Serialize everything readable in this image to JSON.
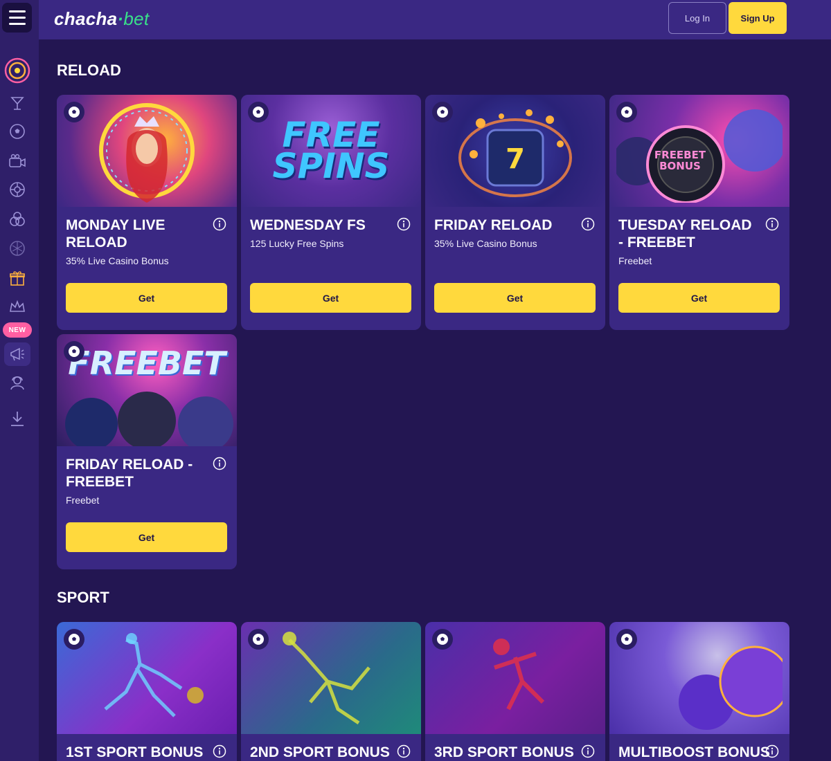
{
  "header": {
    "logo_main": "chacha",
    "logo_dot": "·",
    "logo_bet": "bet",
    "login_label": "Log In",
    "signup_label": "Sign Up"
  },
  "sidebar": {
    "new_badge": "NEW",
    "items": [
      "target-icon",
      "cocktail-icon",
      "soccer-ball-icon",
      "live-camera-icon",
      "roulette-icon",
      "cards-icon",
      "soccer-ball-alt-icon",
      "gift-icon",
      "crown-icon",
      "megaphone-icon",
      "support-icon",
      "download-icon"
    ]
  },
  "sections": [
    {
      "title": "RELOAD",
      "cards": [
        {
          "title": "MONDAY LIVE RELOAD",
          "subtitle": "35% Live Casino Bonus",
          "button": "Get",
          "art": "queen"
        },
        {
          "title": "WEDNESDAY FS",
          "subtitle": "125 Lucky Free Spins",
          "button": "Get",
          "art_text": "FREE SPINS"
        },
        {
          "title": "FRIDAY RELOAD",
          "subtitle": "35% Live Casino Bonus",
          "button": "Get",
          "art": "slot"
        },
        {
          "title": "TUESDAY RELOAD - FREEBET",
          "subtitle": "Freebet",
          "button": "Get",
          "art_text": "FREEBET BONUS"
        },
        {
          "title": "FRIDAY RELOAD - FREEBET",
          "subtitle": "Freebet",
          "button": "Get",
          "art_text": "FREEBET"
        }
      ]
    },
    {
      "title": "SPORT",
      "cards": [
        {
          "title": "1ST SPORT BONUS",
          "art": "soccer-player"
        },
        {
          "title": "2ND SPORT BONUS",
          "art": "goalkeeper"
        },
        {
          "title": "3RD SPORT BONUS",
          "art": "basketball-player"
        },
        {
          "title": "MULTIBOOST BONUS",
          "art": "balls"
        }
      ]
    }
  ],
  "colors": {
    "background": "#231652",
    "card": "#3a2883",
    "button": "#ffd93d",
    "accent_green": "#39e08a"
  }
}
